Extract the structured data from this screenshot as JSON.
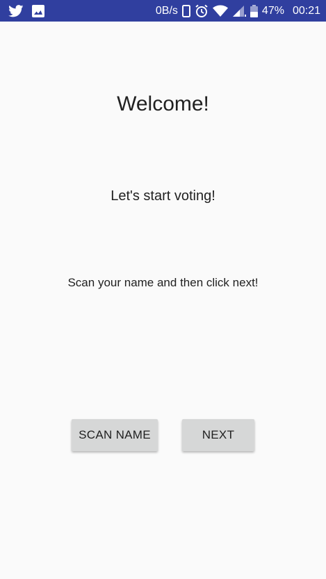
{
  "status_bar": {
    "network_speed": "0B/s",
    "battery_percent": "47%",
    "time": "00:21",
    "icons": [
      "twitter-icon",
      "image-icon",
      "phone-icon",
      "alarm-icon",
      "wifi-icon",
      "signal-icon",
      "battery-icon"
    ],
    "background_color": "#303f9f"
  },
  "main": {
    "title": "Welcome!",
    "subtitle": "Let's start voting!",
    "instruction": "Scan your name and then click next!"
  },
  "buttons": {
    "scan_label": "SCAN NAME",
    "next_label": "NEXT"
  }
}
